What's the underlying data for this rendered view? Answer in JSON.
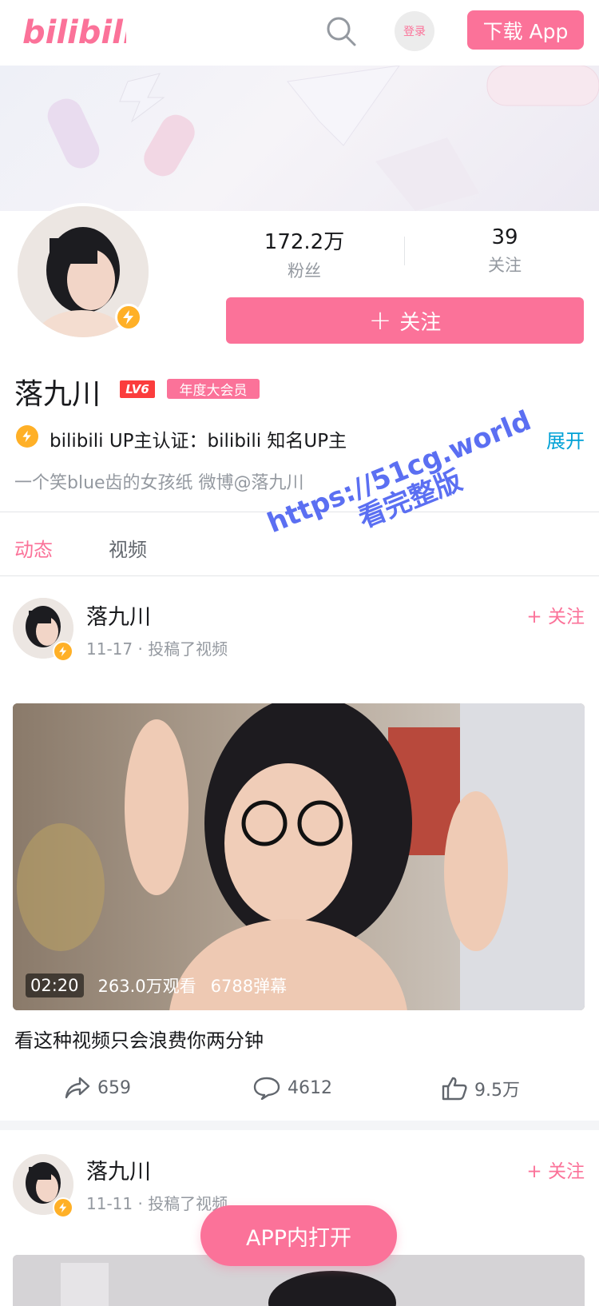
{
  "header": {
    "logo_text": "bilibili",
    "login_label": "登录",
    "download_label": "下载 App"
  },
  "profile": {
    "stats": [
      {
        "value": "172.2万",
        "label": "粉丝"
      },
      {
        "value": "39",
        "label": "关注"
      }
    ],
    "follow_label": "关注",
    "name": "落九川",
    "level": "LV6",
    "vip_label": "年度大会员",
    "certification": "bilibili UP主认证：bilibili 知名UP主",
    "expand_label": "展开",
    "bio": "一个笑blue齿的女孩纸 微博@落九川"
  },
  "tabs": [
    {
      "label": "动态",
      "active": true
    },
    {
      "label": "视频",
      "active": false
    }
  ],
  "posts": [
    {
      "author": "落九川",
      "meta": "11-17 · 投稿了视频",
      "follow_label": "+ 关注",
      "duration": "02:20",
      "views": "263.0万观看",
      "danmaku": "6788弹幕",
      "title": "看这种视频只会浪费你两分钟",
      "shares": "659",
      "comments": "4612",
      "likes": "9.5万"
    },
    {
      "author": "落九川",
      "meta": "11-11 · 投稿了视频",
      "follow_label": "+ 关注"
    }
  ],
  "watermark": {
    "line1": "https://51cg.world",
    "line2": "看完整版"
  },
  "open_app_label": "APP内打开",
  "colors": {
    "brand_pink": "#fb7299",
    "link_blue": "#00a1d6",
    "verify_gold": "#ffb027"
  }
}
